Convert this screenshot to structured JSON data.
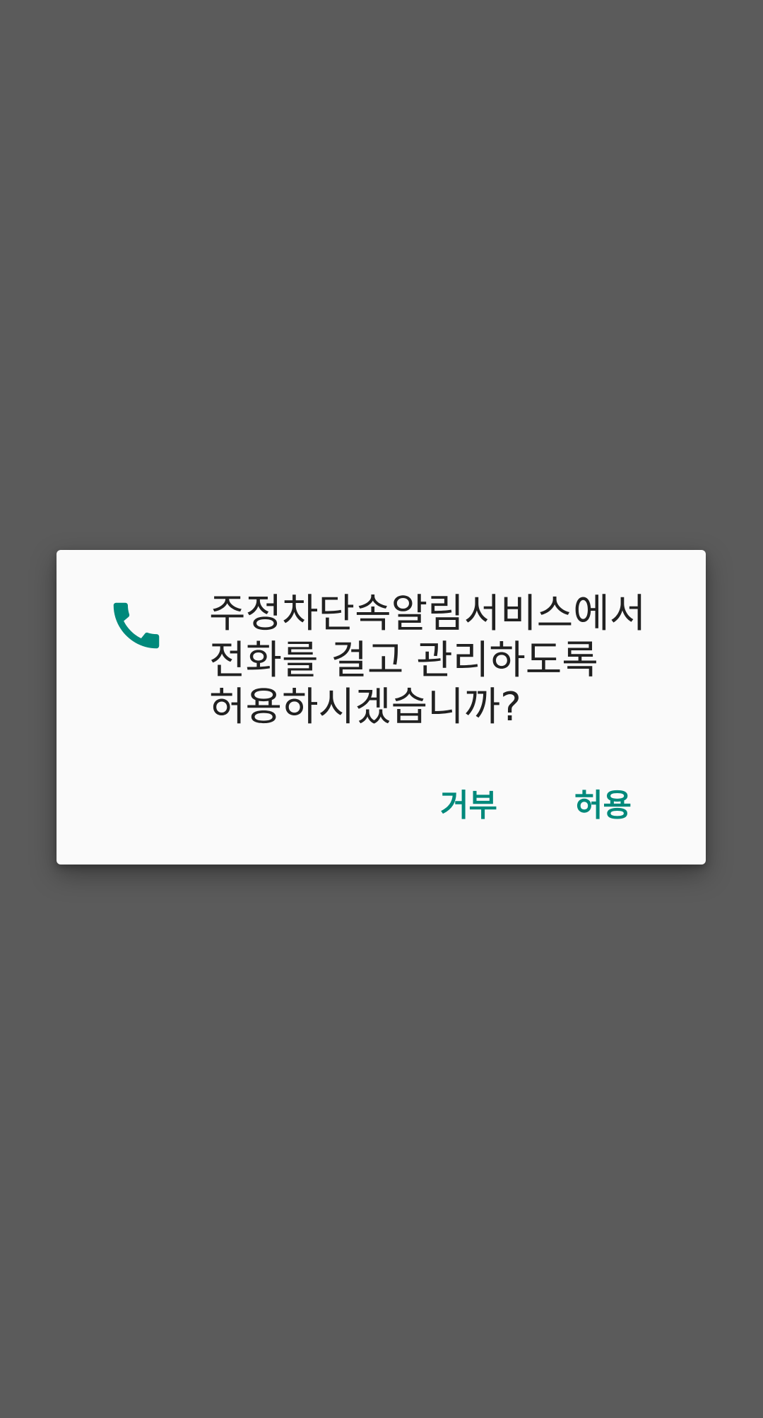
{
  "dialog": {
    "icon": "phone-icon",
    "message": "주정차단속알림서비스에서 전화를 걸고 관리하도록 허용하시겠습니까?",
    "deny_label": "거부",
    "allow_label": "허용"
  },
  "colors": {
    "accent": "#00897b",
    "scrim": "#5b5b5b",
    "dialog_bg": "#fafafa",
    "text": "#212121"
  }
}
